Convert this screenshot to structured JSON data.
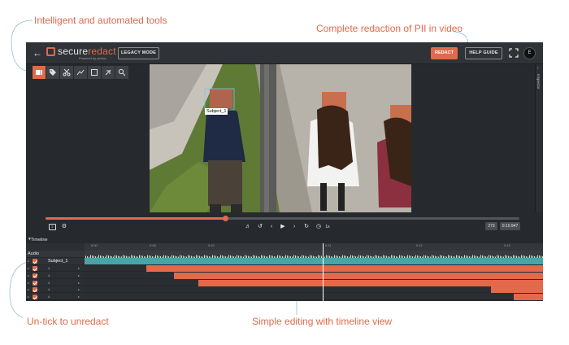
{
  "callouts": {
    "tools": "Intelligent and automated tools",
    "redaction": "Complete redaction of PII in video",
    "untick": "Un-tick to unredact",
    "timeline": "Simple editing with timeline view"
  },
  "header": {
    "logo_prefix": "secure",
    "logo_suffix": "redact",
    "logo_sub": "Powered by pimloc",
    "legacy_mode": "LEGACY MODE",
    "redact": "REDACT",
    "help_guide": "HELP GUIDE",
    "avatar_initial": "E"
  },
  "toolbar": {
    "tools": [
      "redact-tool-icon",
      "tag-icon",
      "scissors-icon",
      "path-icon",
      "frame-icon",
      "no-detect-icon",
      "search-icon"
    ]
  },
  "video": {
    "subject_label": "Subject_1"
  },
  "inspector": {
    "label": "Inspector"
  },
  "playback": {
    "progress": 0.38,
    "speed": "1x",
    "frame": "273",
    "time": "0:10.947"
  },
  "timeline": {
    "header": "Timeline",
    "audio_label": "Audio",
    "subject_label": "Subject_1",
    "ruler_labels": [
      "0:00",
      "0:05",
      "0:10",
      "0:11",
      "0:12",
      "0:13"
    ],
    "row_label": "4"
  },
  "colors": {
    "accent": "#e2694a",
    "teal": "#4a9fa3",
    "app_bg": "#262a2e"
  }
}
